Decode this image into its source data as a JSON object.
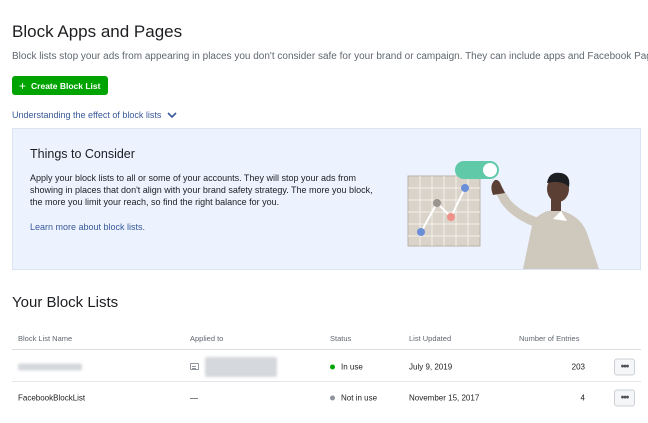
{
  "header": {
    "title": "Block Apps and Pages",
    "description": "Block lists stop your ads from appearing in places you don't consider safe for your brand or campaign. They can include apps and Facebook Pages.",
    "create_button": "Create Block List",
    "understanding_link": "Understanding the effect of block lists"
  },
  "consider": {
    "title": "Things to Consider",
    "body": "Apply your block lists to all or some of your accounts. They will stop your ads from showing in places that don't align with your brand safety strategy. The more you block, the more you limit your reach, so find the right balance for you.",
    "link": "Learn more about block lists."
  },
  "block_lists": {
    "title": "Your Block Lists",
    "columns": [
      "Block List Name",
      "Applied to",
      "Status",
      "List Updated",
      "Number of Entries"
    ],
    "rows": [
      {
        "name": "",
        "applied_to": "",
        "status": "In use",
        "status_color": "#00a400",
        "updated": "July 9, 2019",
        "entries": "203",
        "more": "•••"
      },
      {
        "name": "FacebookBlockList",
        "applied_to": "—",
        "status": "Not in use",
        "status_color": "#90949c",
        "updated": "November 15, 2017",
        "entries": "4",
        "more": "•••"
      }
    ]
  },
  "colors": {
    "primary_green": "#00a400",
    "link_blue": "#385898",
    "info_bg": "#ecf3ff"
  }
}
